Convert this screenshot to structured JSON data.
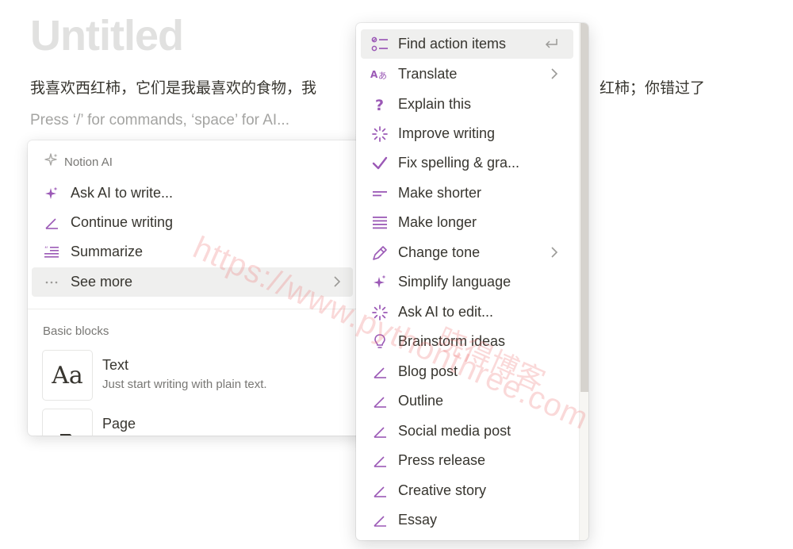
{
  "page": {
    "title": "Untitled",
    "body_text_left": "我喜欢西红柿，它们是我最喜欢的食物，我",
    "body_text_right": "红柿；你错过了",
    "placeholder": "Press ‘/’ for commands, ‘space’ for AI..."
  },
  "slash_menu": {
    "ai_section_label": "Notion AI",
    "ai_items": [
      {
        "label": "Ask AI to write...",
        "icon": "sparkle-icon"
      },
      {
        "label": "Continue writing",
        "icon": "pen-icon"
      },
      {
        "label": "Summarize",
        "icon": "summarize-icon"
      },
      {
        "label": "See more",
        "icon": "more-dots-icon"
      }
    ],
    "basic_section_label": "Basic blocks",
    "blocks": [
      {
        "title": "Text",
        "description": "Just start writing with plain text.",
        "thumb": "Aa"
      },
      {
        "title": "Page",
        "description": "",
        "thumb": "page-icon"
      }
    ]
  },
  "sub_menu": {
    "items": [
      {
        "label": "Find action items",
        "icon": "checklist-icon"
      },
      {
        "label": "Translate",
        "icon": "translate-icon"
      },
      {
        "label": "Explain this",
        "icon": "question-icon"
      },
      {
        "label": "Improve writing",
        "icon": "burst-icon"
      },
      {
        "label": "Fix spelling & gra...",
        "icon": "check-icon"
      },
      {
        "label": "Make shorter",
        "icon": "short-lines-icon"
      },
      {
        "label": "Make longer",
        "icon": "long-lines-icon"
      },
      {
        "label": "Change tone",
        "icon": "pen-nib-icon"
      },
      {
        "label": "Simplify language",
        "icon": "sparkle-icon"
      },
      {
        "label": "Ask AI to edit...",
        "icon": "burst-icon"
      },
      {
        "label": "Brainstorm ideas",
        "icon": "lightbulb-icon"
      },
      {
        "label": "Blog post",
        "icon": "pen-icon"
      },
      {
        "label": "Outline",
        "icon": "pen-icon"
      },
      {
        "label": "Social media post",
        "icon": "pen-icon"
      },
      {
        "label": "Press release",
        "icon": "pen-icon"
      },
      {
        "label": "Creative story",
        "icon": "pen-icon"
      },
      {
        "label": "Essay",
        "icon": "pen-icon"
      }
    ]
  },
  "watermark": {
    "url": "https://www.pythonthree.com",
    "cn": "晓得博客"
  },
  "colors": {
    "ai_purple": "#9b59b6",
    "hover_bg": "#efefee",
    "text": "#37352f",
    "muted": "#787774"
  }
}
